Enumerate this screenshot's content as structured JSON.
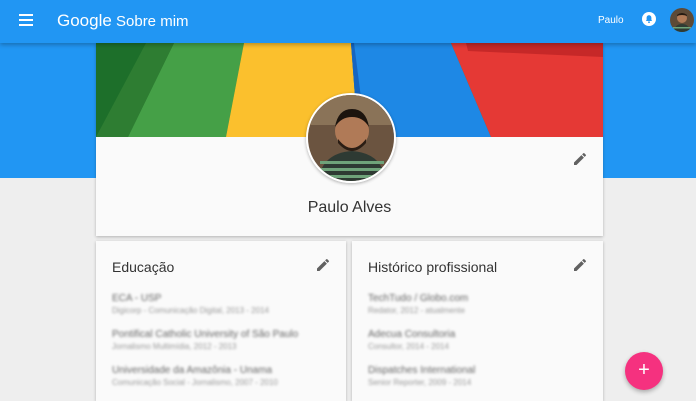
{
  "header": {
    "brand": "Google",
    "title": "Sobre mim",
    "username": "Paulo"
  },
  "profile": {
    "name": "Paulo Alves",
    "cover_colors": [
      "#36a852",
      "#fbc02d",
      "#2196f3",
      "#e53935"
    ]
  },
  "education": {
    "title": "Educação",
    "entries": [
      {
        "title": "ECA - USP",
        "sub": "Digicorp - Comunicação Digital, 2013 - 2014"
      },
      {
        "title": "Pontifical Catholic University of São Paulo",
        "sub": "Jornalismo Multimídia, 2012 - 2013"
      },
      {
        "title": "Universidade da Amazônia - Unama",
        "sub": "Comunicação Social - Jornalismo, 2007 - 2010"
      }
    ]
  },
  "work": {
    "title": "Histórico profissional",
    "entries": [
      {
        "title": "TechTudo / Globo.com",
        "sub": "Redator, 2012 - atualmente"
      },
      {
        "title": "Adecua Consultoria",
        "sub": "Consultor, 2014 - 2014"
      },
      {
        "title": "Dispatches International",
        "sub": "Senior Reporter, 2009 - 2014"
      }
    ]
  },
  "icons": {
    "menu": "menu-icon",
    "notifications": "bell-icon",
    "edit": "pencil-icon",
    "add": "plus-icon"
  },
  "fab_label": "+",
  "colors": {
    "primary": "#2196f3",
    "accent": "#f5317f",
    "background": "#eeeeee"
  }
}
